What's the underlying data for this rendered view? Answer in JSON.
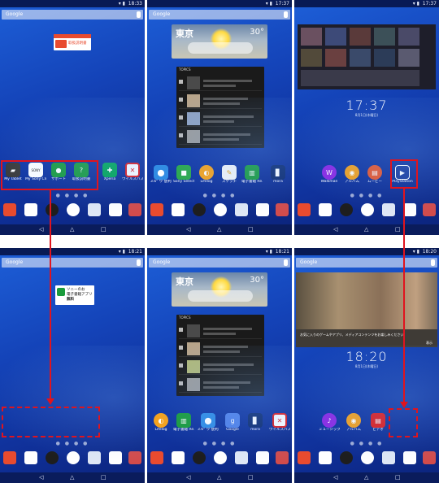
{
  "status_times": [
    "18:33",
    "17:37",
    "17:37",
    "18:21",
    "18:21",
    "18:20"
  ],
  "search_label": "Google",
  "nav_buttons": [
    "◁",
    "△",
    "□"
  ],
  "page_dots": "● ● ● ●",
  "screens": {
    "s1": {
      "notice_label": "取扱説明書",
      "apps": [
        {
          "label": "My Tablet",
          "icon": "tablet-icon",
          "color": "#3c3c3c"
        },
        {
          "label": "My Sony Club",
          "icon": "sony-club-icon",
          "color": "#ffffff"
        },
        {
          "label": "サポート",
          "icon": "support-icon",
          "color": "#1a9b3c"
        },
        {
          "label": "取扱説明書",
          "icon": "manual-icon",
          "color": "#1a9b3c"
        },
        {
          "label": "Xperia",
          "icon": "xperia-icon",
          "color": "#00a651"
        },
        {
          "label": "ウイルスバスター",
          "icon": "virusbuster-icon",
          "color": "#e01b1b"
        }
      ]
    },
    "s2": {
      "weather": {
        "city": "東京",
        "temp": "30°"
      },
      "topics_title": "TOPICS",
      "apps": [
        {
          "label": "3.6\" ウ 使利株",
          "icon": "maps-icon",
          "color": "#2f8be3"
        },
        {
          "label": "Sony Select",
          "icon": "sony-select-icon",
          "color": "#2aa84a"
        },
        {
          "label": "Lifelog",
          "icon": "lifelog-icon",
          "color": "#f6a21a"
        },
        {
          "label": "スケッチ",
          "icon": "sketch-icon",
          "color": "#f5f5f5"
        },
        {
          "label": "電子書籍 Re...",
          "icon": "reader-icon",
          "color": "#1a9b3c"
        },
        {
          "label": "mora",
          "icon": "mora-icon",
          "color": "#0d2a6e"
        }
      ]
    },
    "s3": {
      "clock_time": "17:37",
      "clock_date": "8月1日(木曜日)",
      "apps": [
        {
          "label": "Walkman",
          "icon": "walkman-icon",
          "color": "#8a2be2"
        },
        {
          "label": "アルバム",
          "icon": "album-icon",
          "color": "#f2a01e"
        },
        {
          "label": "ムービー",
          "icon": "movies-icon",
          "color": "#e8552a"
        },
        {
          "label": "PlayStation",
          "icon": "playstation-icon",
          "color": "#1a3a9c"
        }
      ]
    },
    "s4": {
      "notice_title": "ソニーのお",
      "notice_sub": "電子書籍アプリ",
      "notice_free": "無料"
    },
    "s5": {
      "weather": {
        "city": "東京",
        "temp": "30°"
      },
      "topics_title": "TOPICS",
      "apps": [
        {
          "label": "Lifelog",
          "icon": "lifelog-icon",
          "color": "#f6a21a"
        },
        {
          "label": "電子書籍 Re...",
          "icon": "reader-icon",
          "color": "#1a9b3c"
        },
        {
          "label": "3.6\" ウ 使利株",
          "icon": "maps-icon",
          "color": "#2f8be3"
        },
        {
          "label": "Google",
          "icon": "google-icon",
          "color": "#4f7fe6"
        },
        {
          "label": "mora",
          "icon": "mora-icon",
          "color": "#0d2a6e"
        },
        {
          "label": "ウイルスバスター",
          "icon": "virusbuster-icon",
          "color": "#e01b1b"
        }
      ]
    },
    "s6": {
      "banner_text": "お気に入りのゲームやアプリ、メディアコンテンツをお楽しみください。",
      "banner_more": "表示",
      "clock_time": "18:20",
      "clock_date": "8月1日(木曜日)",
      "apps": [
        {
          "label": "ミュージック",
          "icon": "music-icon",
          "color": "#8a2be2"
        },
        {
          "label": "アルバム",
          "icon": "album-icon",
          "color": "#f2a01e"
        },
        {
          "label": "ビデオ",
          "icon": "video-icon",
          "color": "#e01b1b"
        }
      ]
    }
  },
  "dock": [
    {
      "icon": "apps-grid-icon",
      "color": "#e84b2f"
    },
    {
      "icon": "play-store-icon",
      "color": "#ffffff"
    },
    {
      "icon": "camera-icon",
      "color": "#1e1e1e"
    },
    {
      "icon": "app-drawer-icon",
      "color": "#ffffff"
    },
    {
      "icon": "email-icon",
      "color": "#dfe7f5"
    },
    {
      "icon": "calendar-icon",
      "color": "#ffffff"
    },
    {
      "icon": "utilities-icon",
      "color": "#d24b4b"
    }
  ]
}
